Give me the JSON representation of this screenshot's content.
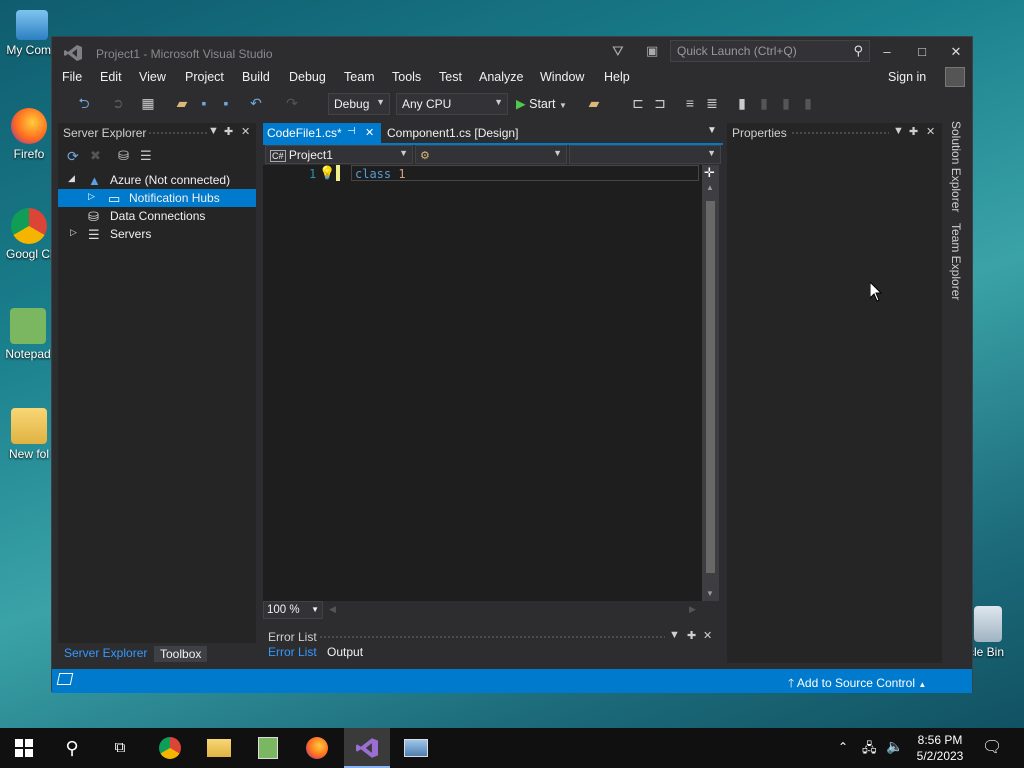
{
  "desktop": {
    "icons": [
      {
        "label": "My Comp"
      },
      {
        "label": "Firefo"
      },
      {
        "label": "Googl Chron"
      },
      {
        "label": "Notepad"
      },
      {
        "label": "New fol"
      },
      {
        "label": "cle Bin"
      }
    ]
  },
  "window": {
    "title": "Project1 - Microsoft Visual Studio",
    "quick_launch_placeholder": "Quick Launch (Ctrl+Q)",
    "sign_in": "Sign in",
    "minimize": "–",
    "maximize": "□",
    "close": "✕"
  },
  "menu": [
    "File",
    "Edit",
    "View",
    "Project",
    "Build",
    "Debug",
    "Team",
    "Tools",
    "Test",
    "Analyze",
    "Window",
    "Help"
  ],
  "toolbar": {
    "config": "Debug",
    "platform": "Any CPU",
    "start": "Start"
  },
  "server_explorer": {
    "title": "Server Explorer",
    "nodes": [
      {
        "label": "Azure (Not connected)",
        "expanded": true
      },
      {
        "label": "Notification Hubs",
        "selected": true
      },
      {
        "label": "Data Connections"
      },
      {
        "label": "Servers"
      }
    ],
    "bottom_tabs": [
      "Server Explorer",
      "Toolbox"
    ]
  },
  "editor": {
    "tabs": [
      {
        "label": "CodeFile1.cs*",
        "active": true
      },
      {
        "label": "Component1.cs [Design]",
        "active": false
      }
    ],
    "nav_project": "Project1",
    "line_number": "1",
    "code_keyword": "class",
    "code_rest": "1",
    "zoom": "100 %"
  },
  "error_panel": {
    "title": "Error List",
    "tabs": [
      "Error List",
      "Output"
    ]
  },
  "properties": {
    "title": "Properties"
  },
  "side_tabs": [
    "Solution Explorer",
    "Team Explorer"
  ],
  "status": {
    "source_control": "Add to Source Control"
  },
  "taskbar": {
    "time": "8:56 PM",
    "date": "5/2/2023"
  },
  "colors": {
    "accent": "#007acc",
    "window_bg": "#2d2d30",
    "editor_bg": "#1e1e1e",
    "keyword": "#569cd6"
  }
}
